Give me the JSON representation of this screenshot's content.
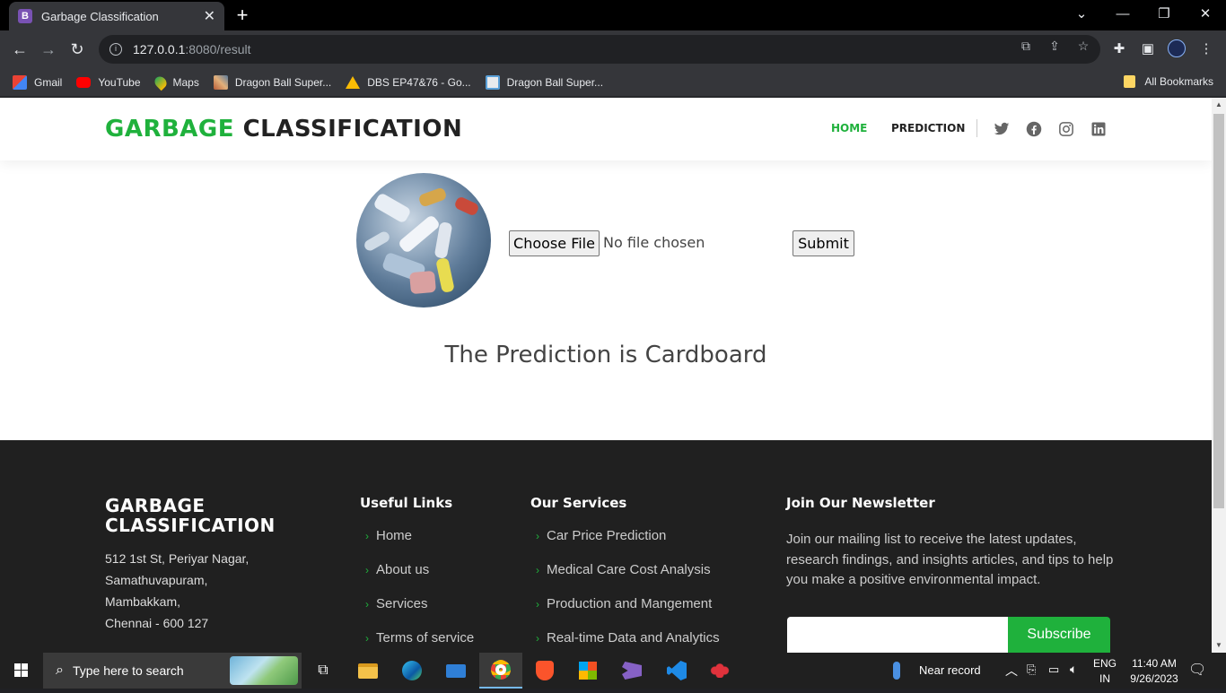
{
  "browser": {
    "tab_title": "Garbage Classification",
    "tab_favicon": "B",
    "url_host": "127.0.0.1",
    "url_path": ":8080/result",
    "bookmarks": [
      "Gmail",
      "YouTube",
      "Maps",
      "Dragon Ball Super...",
      "DBS EP47&76 - Go...",
      "Dragon Ball Super..."
    ],
    "all_bookmarks": "All Bookmarks"
  },
  "header": {
    "logo_accent": "GARBAGE",
    "logo_rest": " CLASSIFICATION",
    "nav": [
      "HOME",
      "PREDICTION"
    ],
    "social_icons": [
      "twitter-icon",
      "facebook-icon",
      "instagram-icon",
      "linkedin-icon"
    ],
    "accent_color": "#1fb13c"
  },
  "main": {
    "choose_file": "Choose File",
    "file_status": "No file chosen",
    "submit": "Submit",
    "prediction": "The Prediction is Cardboard"
  },
  "footer": {
    "brand_line1": "GARBAGE",
    "brand_line2": "CLASSIFICATION",
    "address": [
      "512 1st St, Periyar Nagar,",
      "Samathuvapuram,",
      "Mambakkam,",
      "Chennai - 600 127"
    ],
    "useful_links_title": "Useful Links",
    "useful_links": [
      "Home",
      "About us",
      "Services",
      "Terms of service"
    ],
    "services_title": "Our Services",
    "services": [
      "Car Price Prediction",
      "Medical Care Cost Analysis",
      "Production and Mangement",
      "Real-time Data and Analytics"
    ],
    "newsletter_title": "Join Our Newsletter",
    "newsletter_text": "Join our mailing list to receive the latest updates, research findings, and insights articles, and tips to help you make a positive environmental impact.",
    "subscribe": "Subscribe"
  },
  "taskbar": {
    "search_placeholder": "Type here to search",
    "weather": "Near record",
    "lang_top": "ENG",
    "lang_bottom": "IN",
    "time": "11:40 AM",
    "date": "9/26/2023"
  }
}
